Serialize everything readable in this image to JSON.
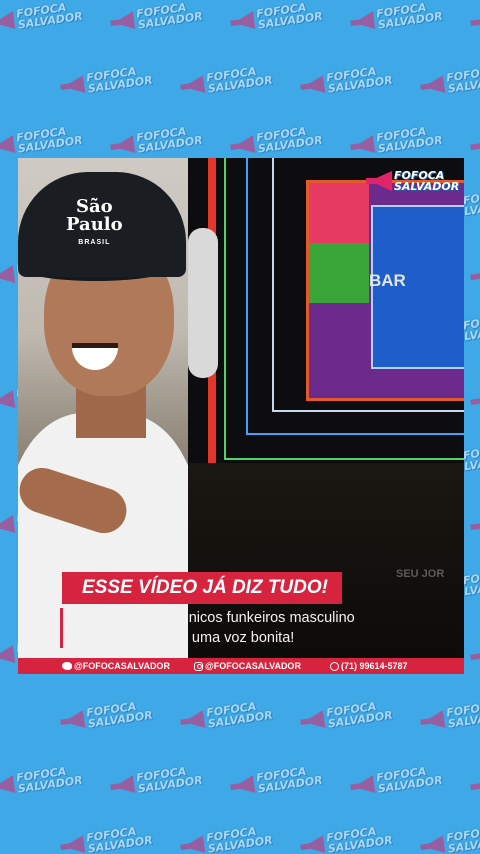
{
  "watermark": {
    "line1": "FOFOCA",
    "line2": "SALVADOR"
  },
  "video_overlay": {
    "logo_line1": "FOFOCA",
    "logo_line2": "SALVADOR",
    "screen_text": "BAR",
    "corner_text": "SEU JOR",
    "cap_text_line1": "São",
    "cap_text_line2": "Paulo",
    "cap_text_line3": "BRASIL"
  },
  "caption": {
    "headline": "ESSE VÍDEO JÁ DIZ TUDO!",
    "subtitle_line1": "Livinho é um dos únicos funkeiros masculino",
    "subtitle_line2": "que realmente tem uma voz bonita!"
  },
  "footer": {
    "twitter": "@FOFOCASALVADOR",
    "instagram": "@FOFOCASALVADOR",
    "whatsapp": "(71) 99614-5787"
  },
  "colors": {
    "background": "#3fa8e6",
    "accent": "#d6243f",
    "brand_pink": "#e0246a"
  }
}
